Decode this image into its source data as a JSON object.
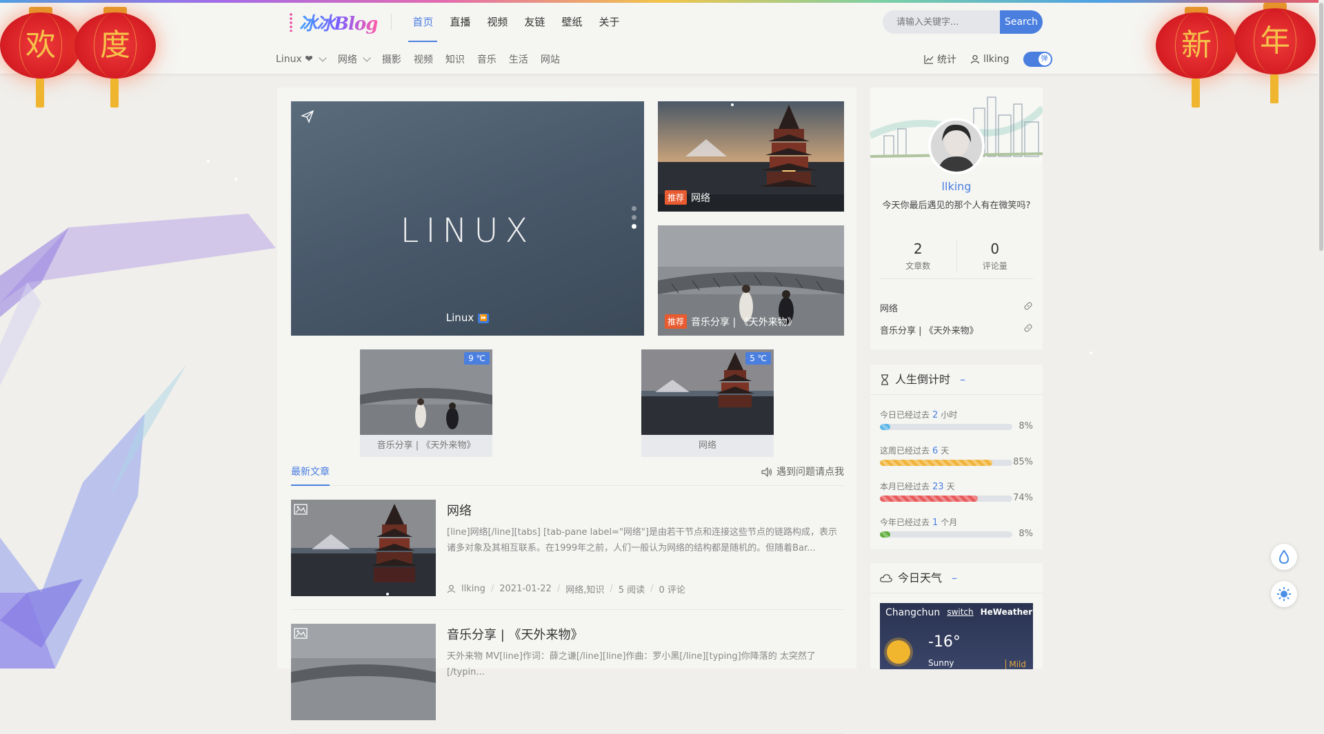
{
  "topnav": {
    "logo": "冰冰Blog",
    "items": [
      "首页",
      "直播",
      "视频",
      "友链",
      "壁纸",
      "关于"
    ],
    "active_index": 0
  },
  "search": {
    "placeholder": "请输入关键字...",
    "button": "Search"
  },
  "subnav": {
    "items": [
      "Linux ❤",
      "网络",
      "摄影",
      "视频",
      "知识",
      "音乐",
      "生活",
      "网站"
    ]
  },
  "rightnav": {
    "stats": "统计",
    "user": "llking",
    "toggle": "弹"
  },
  "lanterns": [
    "欢",
    "度",
    "新",
    "年"
  ],
  "carousel": {
    "slide_text": "LINUX",
    "caption": "Linux",
    "caption_badge": "⏩"
  },
  "featured": [
    {
      "tag": "推荐",
      "title": "网络"
    },
    {
      "tag": "推荐",
      "title": "音乐分享 | 《天外来物》"
    }
  ],
  "tiles": [
    {
      "temp": "9 ℃",
      "label": "音乐分享 | 《天外来物》"
    },
    {
      "temp": "5 ℃",
      "label": "网络"
    }
  ],
  "tabs": {
    "latest": "最新文章",
    "help": "遇到问题请点我"
  },
  "posts": [
    {
      "title": "网络",
      "excerpt": "[line]网络[/line][tabs] [tab-pane label=\"网络\"]是由若干节点和连接这些节点的链路构成，表示诸多对象及其相互联系。在1999年之前，人们一般认为网络的结构都是随机的。但随着Bar...",
      "author": "llking",
      "date": "2021-01-22",
      "category": "网络,知识",
      "reads": "5 阅读",
      "comments": "0 评论"
    },
    {
      "title": "音乐分享 | 《天外来物》",
      "excerpt": "天外来物 MV[line]作词：薛之谦[/line][line]作曲：罗小黑[/line][typing]你降落的 太突然了 [/typin...",
      "author": "",
      "date": "",
      "category": "",
      "reads": "",
      "comments": ""
    }
  ],
  "profile": {
    "name": "llking",
    "bio": "今天你最后遇见的那个人有在微笑吗?",
    "posts_count": "2",
    "posts_label": "文章数",
    "comments_count": "0",
    "comments_label": "评论量",
    "links": [
      "网络",
      "音乐分享 | 《天外来物》"
    ]
  },
  "countdown": {
    "title": "人生倒计时",
    "items": [
      {
        "prefix": "今日已经过去",
        "value": "2",
        "unit": "小时",
        "percent": 8,
        "pct_label": "8%",
        "color": "#5bb6e8"
      },
      {
        "prefix": "这周已经过去",
        "value": "6",
        "unit": "天",
        "percent": 85,
        "pct_label": "85%",
        "color": "#f0b43a"
      },
      {
        "prefix": "本月已经过去",
        "value": "23",
        "unit": "天",
        "percent": 74,
        "pct_label": "74%",
        "color": "#e85a5a"
      },
      {
        "prefix": "今年已经过去",
        "value": "1",
        "unit": "个月",
        "percent": 8,
        "pct_label": "8%",
        "color": "#5fae3a"
      }
    ]
  },
  "weather": {
    "title": "今日天气",
    "city": "Changchun",
    "switch": "switch",
    "provider": "HeWeather",
    "temp": "-16°",
    "condition": "Sunny",
    "mild": "Mild"
  },
  "colors": {
    "accent": "#4a7fe0",
    "badge": "#e85a30",
    "lantern": "#d61e24"
  }
}
